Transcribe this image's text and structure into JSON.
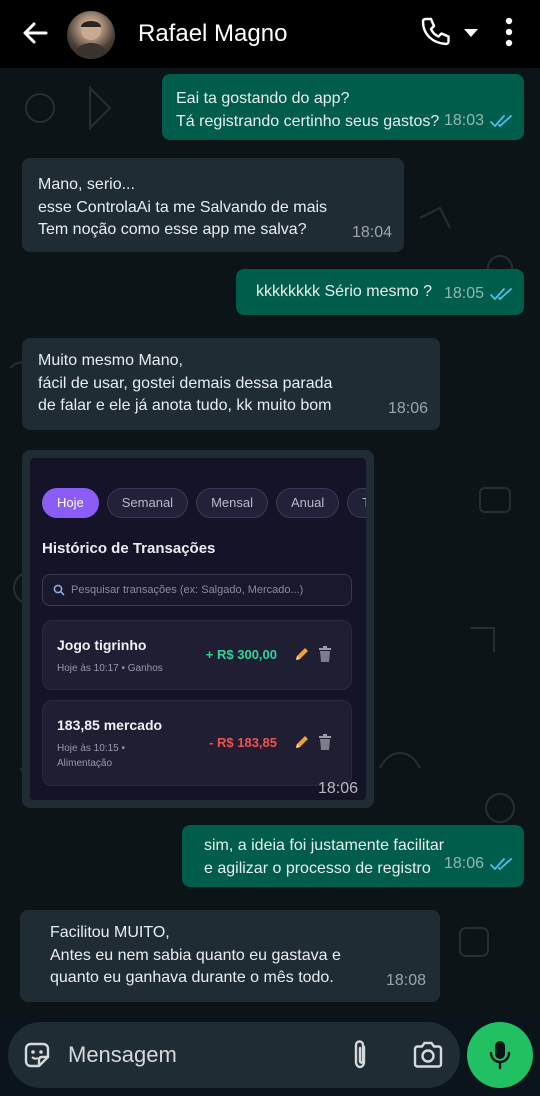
{
  "header": {
    "contact_name": "Rafael Magno",
    "icons": [
      "back-arrow-icon",
      "avatar",
      "phone-icon",
      "dropdown-arrow-icon",
      "more-vertical-icon"
    ]
  },
  "messages": [
    {
      "direction": "out",
      "text": "Eai ta gostando do app?\nTá registrando certinho seus gastos?",
      "time": "18:03",
      "status": "read"
    },
    {
      "direction": "in",
      "text": "Mano, serio...\nesse ControlaAi ta me Salvando de mais\nTem noção como esse app me salva?",
      "time": "18:04"
    },
    {
      "direction": "out",
      "text": "kkkkkkkk Sério mesmo ?",
      "time": "18:05",
      "status": "read"
    },
    {
      "direction": "in",
      "text": "Muito mesmo Mano,\nfácil de usar, gostei demais dessa parada\nde falar e ele já anota tudo, kk muito bom",
      "time": "18:06"
    },
    {
      "direction": "out",
      "text": "sim, a ideia foi justamente facilitar\ne agilizar o processo de registro",
      "time": "18:06",
      "status": "read"
    },
    {
      "direction": "in",
      "text": "Facilitou MUITO,\nAntes eu nem sabia quanto eu gastava e\nquanto eu ganhava durante o mês todo.",
      "time": "18:08"
    }
  ],
  "image_message": {
    "time": "18:06",
    "screenshot": {
      "tabs": [
        "Hoje",
        "Semanal",
        "Mensal",
        "Anual",
        "T"
      ],
      "active_tab": "Hoje",
      "section_title": "Histórico de Transações",
      "search_placeholder": "Pesquisar transações (ex: Salgado, Mercado...)",
      "transactions": [
        {
          "title": "Jogo tigrinho",
          "subtitle": "Hoje às 10:17 • Ganhos",
          "amount": "+ R$ 300,00",
          "type": "income"
        },
        {
          "title": "183,85 mercado",
          "subtitle": "Hoje às 10:15 • Alimentação",
          "amount": "- R$ 183,85",
          "type": "expense"
        }
      ],
      "colors": {
        "accent": "#8b5cf6",
        "income": "#34d399",
        "expense": "#f05252"
      }
    }
  },
  "input_bar": {
    "placeholder": "Mensagem",
    "icons": [
      "sticker-icon",
      "attach-icon",
      "camera-icon",
      "mic-icon"
    ]
  },
  "colors": {
    "outgoing_bubble": "#005c4b",
    "incoming_bubble": "#202c33",
    "read_ticks": "#53bdeb",
    "mic_button": "#21c063"
  }
}
